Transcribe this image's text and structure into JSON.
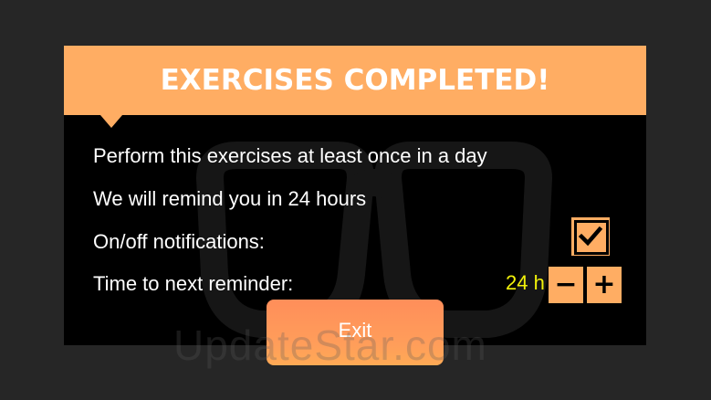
{
  "dialog": {
    "title": "EXERCISES COMPLETED!",
    "lines": [
      "Perform this exercises at least once in a day",
      "We will remind you in 24 hours",
      "On/off notifications:",
      "Time to next reminder:"
    ],
    "notifications_checked": true,
    "reminder_value": "24 h",
    "minus_label": "−",
    "plus_label": "+",
    "exit_label": "Exit"
  },
  "watermark": {
    "text": "UpdateStar.com"
  },
  "colors": {
    "accent": "#ffad63",
    "time_value": "#f2f20a",
    "exit_button": "#ff8e5a",
    "background": "#262626",
    "dialog_bg": "#000000"
  },
  "icons": [
    "checkmark-icon",
    "minus-icon",
    "plus-icon",
    "glasses-watermark-icon"
  ]
}
